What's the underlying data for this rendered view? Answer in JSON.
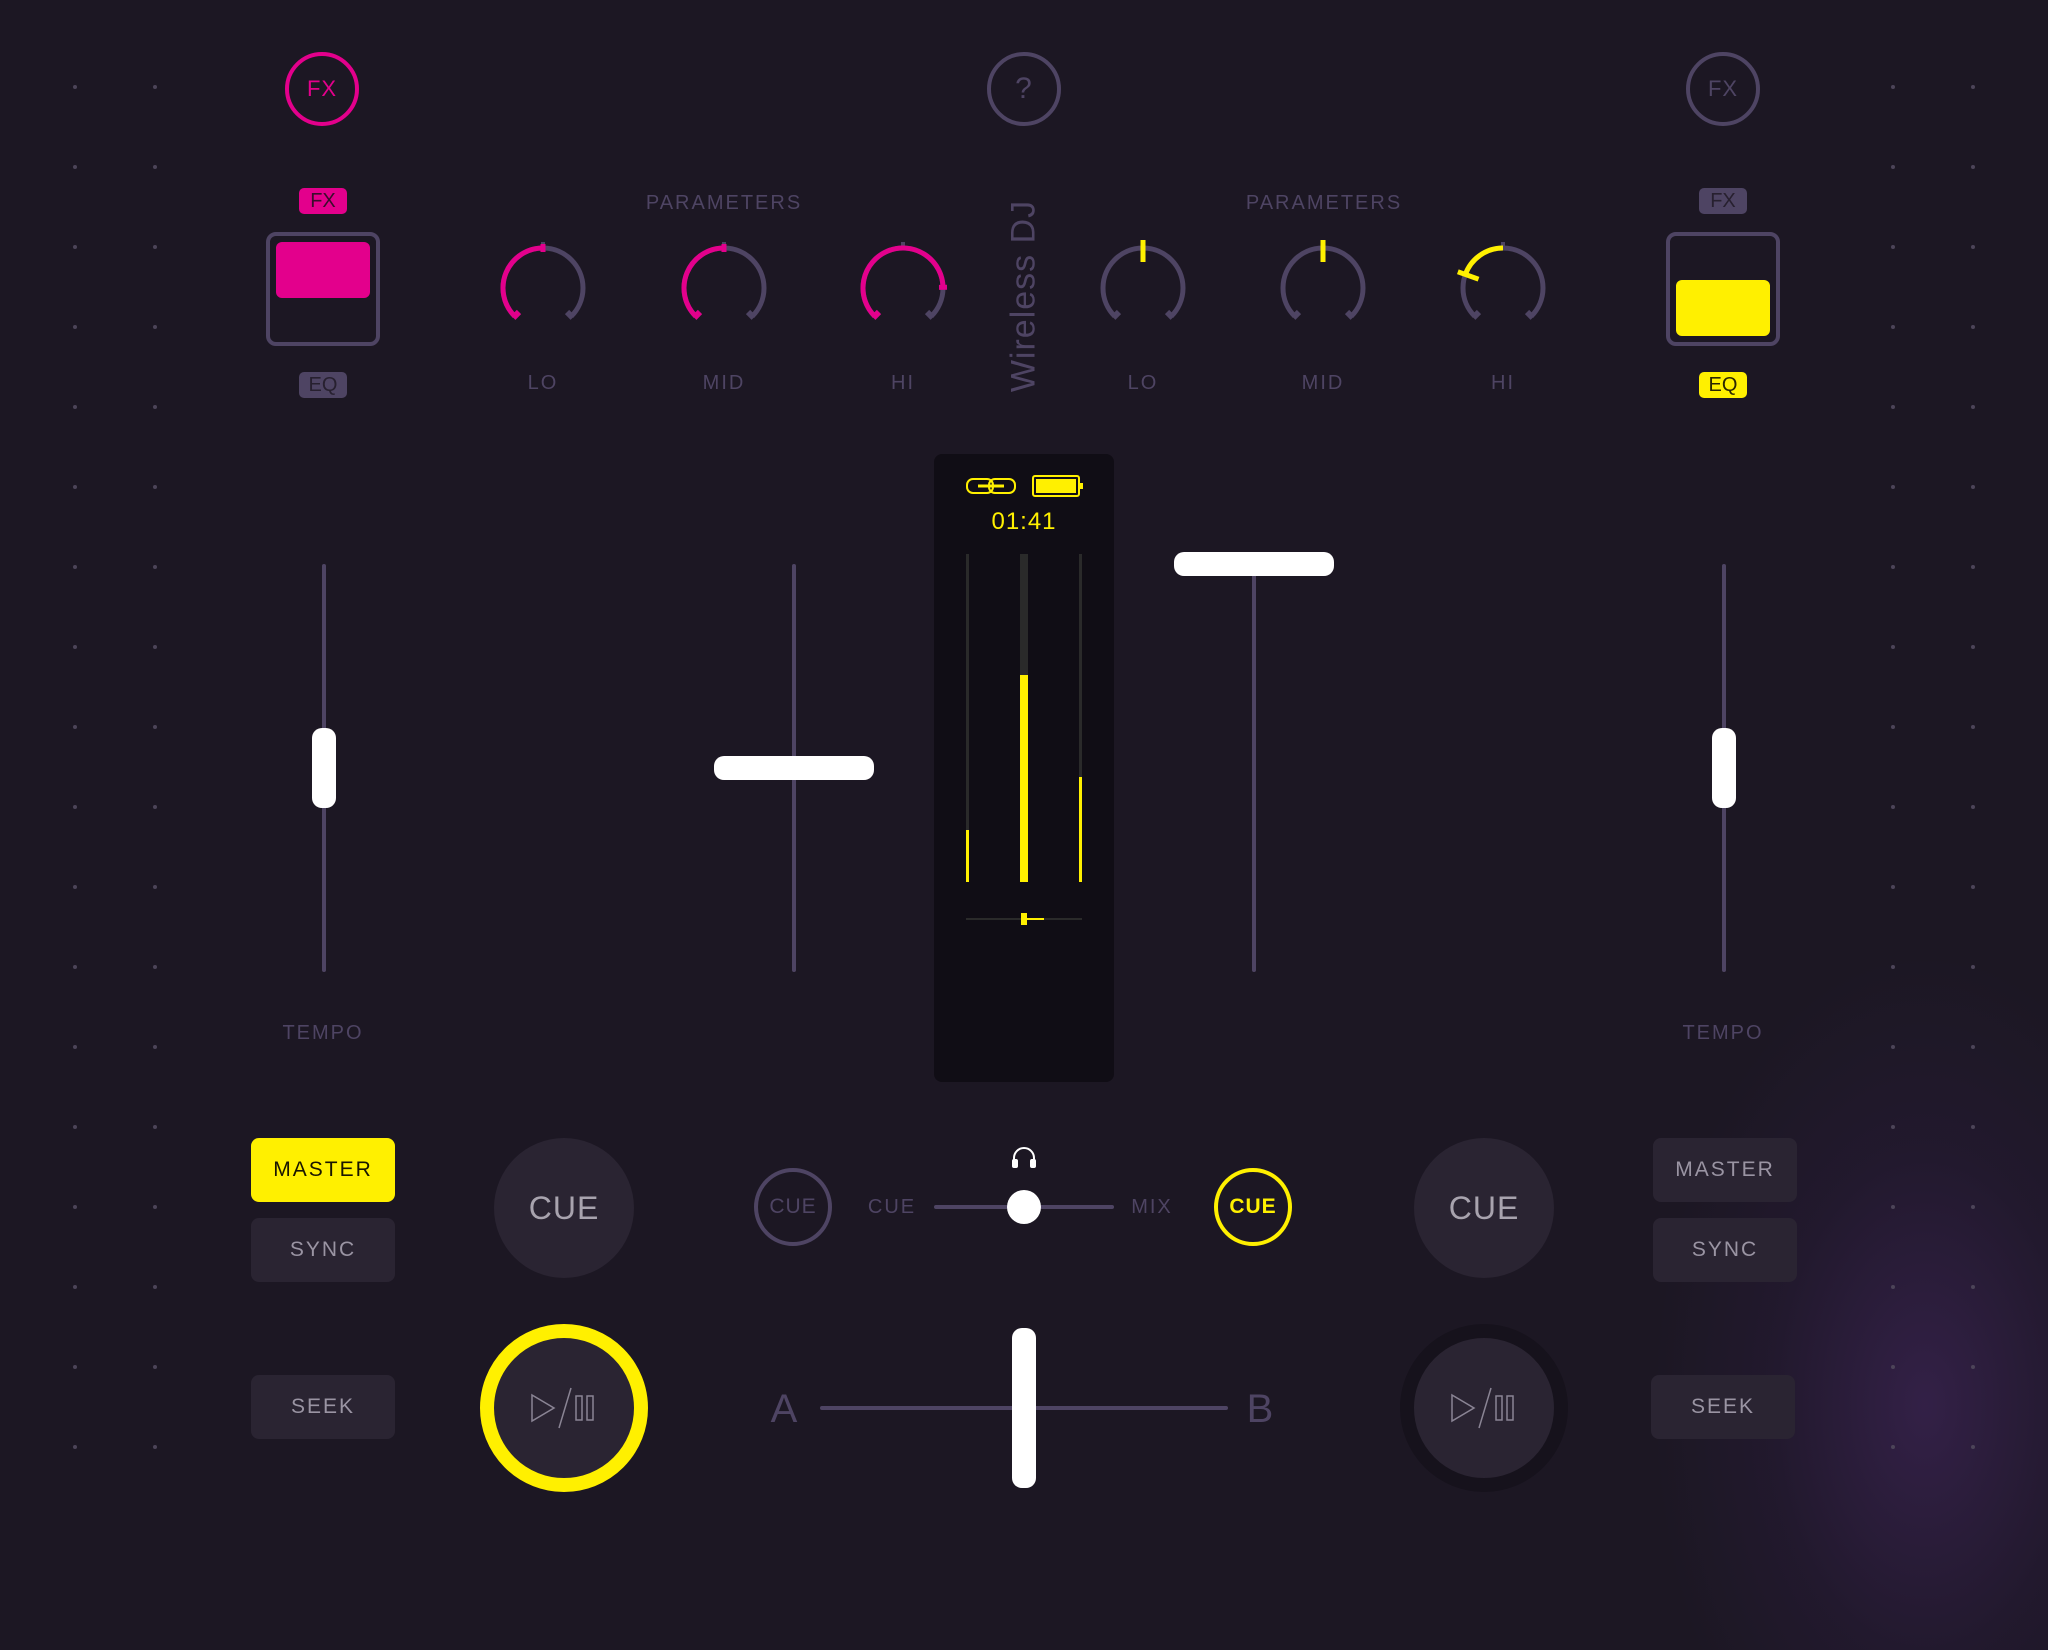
{
  "app": {
    "title": "Wireless DJ"
  },
  "colors": {
    "deck_a_accent": "#e3008c",
    "deck_b_accent": "#fff000",
    "inactive": "#4e4463",
    "background": "#1c1723",
    "button_bg": "#2a2432",
    "handle": "#ffffff"
  },
  "header": {
    "help_icon": "question-mark-icon",
    "help_label": "?"
  },
  "deck_a": {
    "fx_button_label": "FX",
    "fx_button_active": true,
    "mode_switch": {
      "top_label": "FX",
      "bottom_label": "EQ",
      "selected": "FX"
    },
    "parameters_title": "PARAMETERS",
    "knobs": [
      {
        "label": "LO",
        "value": 0.5
      },
      {
        "label": "MID",
        "value": 0.5
      },
      {
        "label": "HI",
        "value": 0.83
      }
    ],
    "knob_fill_mode": "from-min",
    "tempo": {
      "label": "TEMPO",
      "value": 0.5
    },
    "volume": {
      "value": 0.5
    },
    "master_label": "MASTER",
    "master_active": true,
    "sync_label": "SYNC",
    "seek_label": "SEEK",
    "cue_label": "CUE",
    "headphone_cue_label": "CUE",
    "headphone_cue_active": false,
    "play_pause_icon": "play-pause-icon",
    "playing": true
  },
  "deck_b": {
    "fx_button_label": "FX",
    "fx_button_active": false,
    "mode_switch": {
      "top_label": "FX",
      "bottom_label": "EQ",
      "selected": "EQ"
    },
    "parameters_title": "PARAMETERS",
    "knobs": [
      {
        "label": "LO",
        "value": 0.5
      },
      {
        "label": "MID",
        "value": 0.5
      },
      {
        "label": "HI",
        "value": 0.24
      }
    ],
    "knob_fill_mode": "from-center",
    "tempo": {
      "label": "TEMPO",
      "value": 0.5
    },
    "volume": {
      "value": 1.0
    },
    "master_label": "MASTER",
    "master_active": false,
    "sync_label": "SYNC",
    "seek_label": "SEEK",
    "cue_label": "CUE",
    "headphone_cue_label": "CUE",
    "headphone_cue_active": true,
    "play_pause_icon": "play-pause-icon",
    "playing": false
  },
  "center": {
    "link_icon": "link-icon",
    "battery_icon": "battery-icon",
    "battery_level": 1.0,
    "time": "01:41",
    "meters": {
      "left": 0.16,
      "master": 0.63,
      "right": 0.32
    },
    "balance": 0.5
  },
  "cue_mix": {
    "headphones_icon": "headphones-icon",
    "left_label": "CUE",
    "right_label": "MIX",
    "value": 0.5
  },
  "crossfader": {
    "left_label": "A",
    "right_label": "B",
    "value": 0.5
  }
}
